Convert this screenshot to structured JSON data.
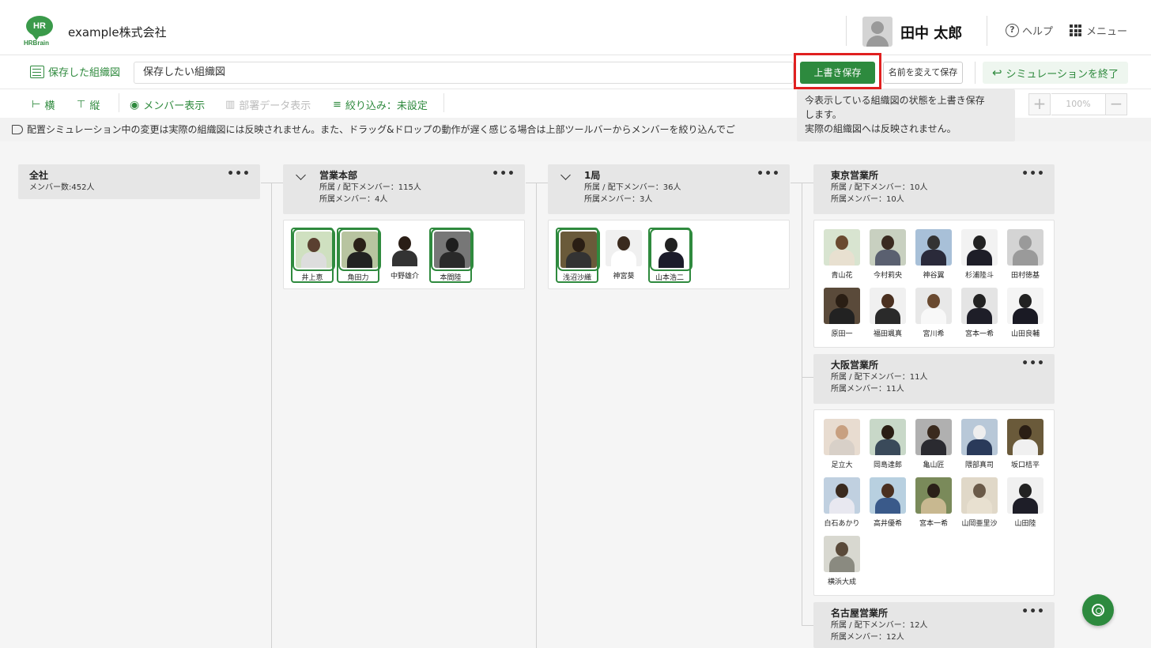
{
  "header": {
    "logo_text": "HR",
    "logo_brand": "HRBrain",
    "company": "example株式会社",
    "user_name": "田中 太郎",
    "help_label": "ヘルプ",
    "menu_label": "メニュー"
  },
  "toolbar": {
    "saved_charts_label": "保存した組織図",
    "chart_name_value": "保存したい組織図",
    "overwrite_label": "上書き保存",
    "save_as_label": "名前を変えて保存",
    "end_simulation_label": "シミュレーションを終了",
    "horizontal_label": "横",
    "vertical_label": "縦",
    "show_members_label": "メンバー表示",
    "dept_data_label": "部署データ表示",
    "filter_label": "絞り込み：未設定",
    "zoom_value": "100%"
  },
  "tooltip": {
    "line1": "今表示している組織図の状態を上書き保存",
    "line2": "します。",
    "line3": "実際の組織図へは反映されません。"
  },
  "notice": "配置シミュレーション中の変更は実際の組織図には反映されません。また、ドラッグ&ドロップの動作が遅く感じる場合は上部ツールバーからメンバーを絞り込んでご",
  "nodes": {
    "zensha": {
      "title": "全社",
      "sub1": "メンバー数:452人"
    },
    "eigyo": {
      "title": "営業本部",
      "sub1": "所属 / 配下メンバー：115人",
      "sub2": "所属メンバー：4人",
      "members": [
        "井上恵",
        "角田力",
        "中野雄介",
        "本間陸"
      ]
    },
    "ikkyoku": {
      "title": "1局",
      "sub1": "所属 / 配下メンバー：36人",
      "sub2": "所属メンバー：3人",
      "members": [
        "浅沼沙織",
        "神宮葵",
        "山本浩二"
      ]
    },
    "tokyo": {
      "title": "東京営業所",
      "sub1": "所属 / 配下メンバー：10人",
      "sub2": "所属メンバー：10人",
      "members": [
        "青山花",
        "今村莉央",
        "神谷翼",
        "杉浦陸斗",
        "田村徳基",
        "原田一",
        "福田颯真",
        "宮川希",
        "宮本一希",
        "山田良輔"
      ]
    },
    "osaka": {
      "title": "大阪営業所",
      "sub1": "所属 / 配下メンバー：11人",
      "sub2": "所属メンバー：11人",
      "members": [
        "足立大",
        "岡島達郎",
        "亀山匠",
        "隈部真司",
        "坂口桔平",
        "白石あかり",
        "高井優希",
        "宮本一希",
        "山岡亜里沙",
        "山田陸",
        "横浜大成"
      ]
    },
    "nagoya": {
      "title": "名古屋営業所",
      "sub1": "所属 / 配下メンバー：12人",
      "sub2": "所属メンバー：12人"
    }
  },
  "colors": {
    "brand": "#2d8a3e",
    "highlight": "#e02020"
  }
}
